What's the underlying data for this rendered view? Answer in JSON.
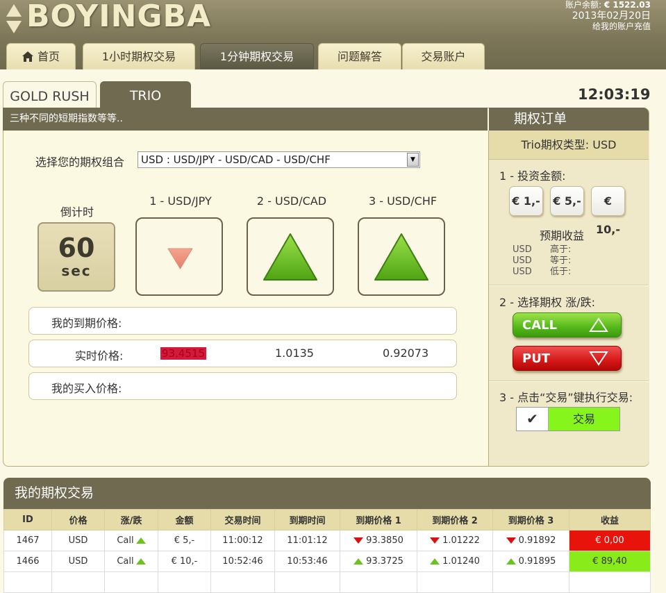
{
  "header": {
    "logo": "BOYINGBA",
    "balance_label": "账户余额:",
    "balance_value": "€ 1522.03",
    "date": "2013年02月20日",
    "recharge": "给我的账户充值"
  },
  "nav": {
    "tabs": [
      {
        "label": "首页",
        "icon": "home-icon"
      },
      {
        "label": "1小时期权交易"
      },
      {
        "label": "1分钟期权交易",
        "active": true
      },
      {
        "label": "问题解答"
      },
      {
        "label": "交易账户"
      }
    ]
  },
  "subtabs": [
    "GOLD RUSH",
    "TRIO"
  ],
  "clock": "12:03:19",
  "main": {
    "description": "三种不同的短期指数等等..",
    "combo_label": "选择您的期权组合",
    "combo_value": "USD : USD/JPY - USD/CAD - USD/CHF",
    "countdown_label": "倒计时",
    "countdown_value": "60",
    "countdown_unit": "sec",
    "pairs": [
      {
        "label": "1 - USD/JPY",
        "direction": "down"
      },
      {
        "label": "2 - USD/CAD",
        "direction": "up"
      },
      {
        "label": "3 - USD/CHF",
        "direction": "up"
      }
    ],
    "expiry_label": "我的到期价格:",
    "realtime_label": "实时价格:",
    "realtime_values": [
      "93.4515",
      "1.0135",
      "0.92073"
    ],
    "buy_label": "我的买入价格:"
  },
  "side": {
    "title": "期权订单",
    "trio_type": "Trio期权类型: USD",
    "step1": "1 - 投资金额:",
    "amounts": [
      "€ 1,-",
      "€ 5,-",
      "€ 10,-"
    ],
    "expected_label": "预期收益",
    "expected_rows": [
      {
        "cur": "USD",
        "label": "高于:"
      },
      {
        "cur": "USD",
        "label": "等于:"
      },
      {
        "cur": "USD",
        "label": "低于:"
      }
    ],
    "step2": "2 - 选择期权 涨/跌:",
    "call": "CALL",
    "put": "PUT",
    "step3": "3 - 点击“交易”键执行交易:",
    "trade_check": "✔",
    "trade": "交易"
  },
  "trades": {
    "title": "我的期权交易",
    "columns": [
      "ID",
      "价格",
      "涨/跌",
      "金额",
      "交易时间",
      "到期时间",
      "到期价格 1",
      "到期价格 2",
      "到期价格 3",
      "收益"
    ],
    "rows": [
      {
        "id": "1467",
        "price": "USD",
        "dir": "Call",
        "amount": "€ 5,-",
        "trade_time": "11:00:12",
        "expiry_time": "11:01:12",
        "p1": "93.3850",
        "p1_dir": "down",
        "p2": "1.01222",
        "p2_dir": "down",
        "p3": "0.91892",
        "p3_dir": "down",
        "profit": "€ 0,00",
        "result": "loss"
      },
      {
        "id": "1466",
        "price": "USD",
        "dir": "Call",
        "amount": "€ 10,-",
        "trade_time": "10:52:46",
        "expiry_time": "10:53:46",
        "p1": "93.3725",
        "p1_dir": "up",
        "p2": "1.01240",
        "p2_dir": "up",
        "p3": "0.91895",
        "p3_dir": "up",
        "profit": "€ 89,40",
        "result": "win"
      }
    ]
  },
  "colors": {
    "brand_dark": "#6f6a50",
    "cream": "#fbf8e6",
    "call_green": "#54b719",
    "put_red": "#d61717",
    "trade_green": "#86f51b"
  }
}
